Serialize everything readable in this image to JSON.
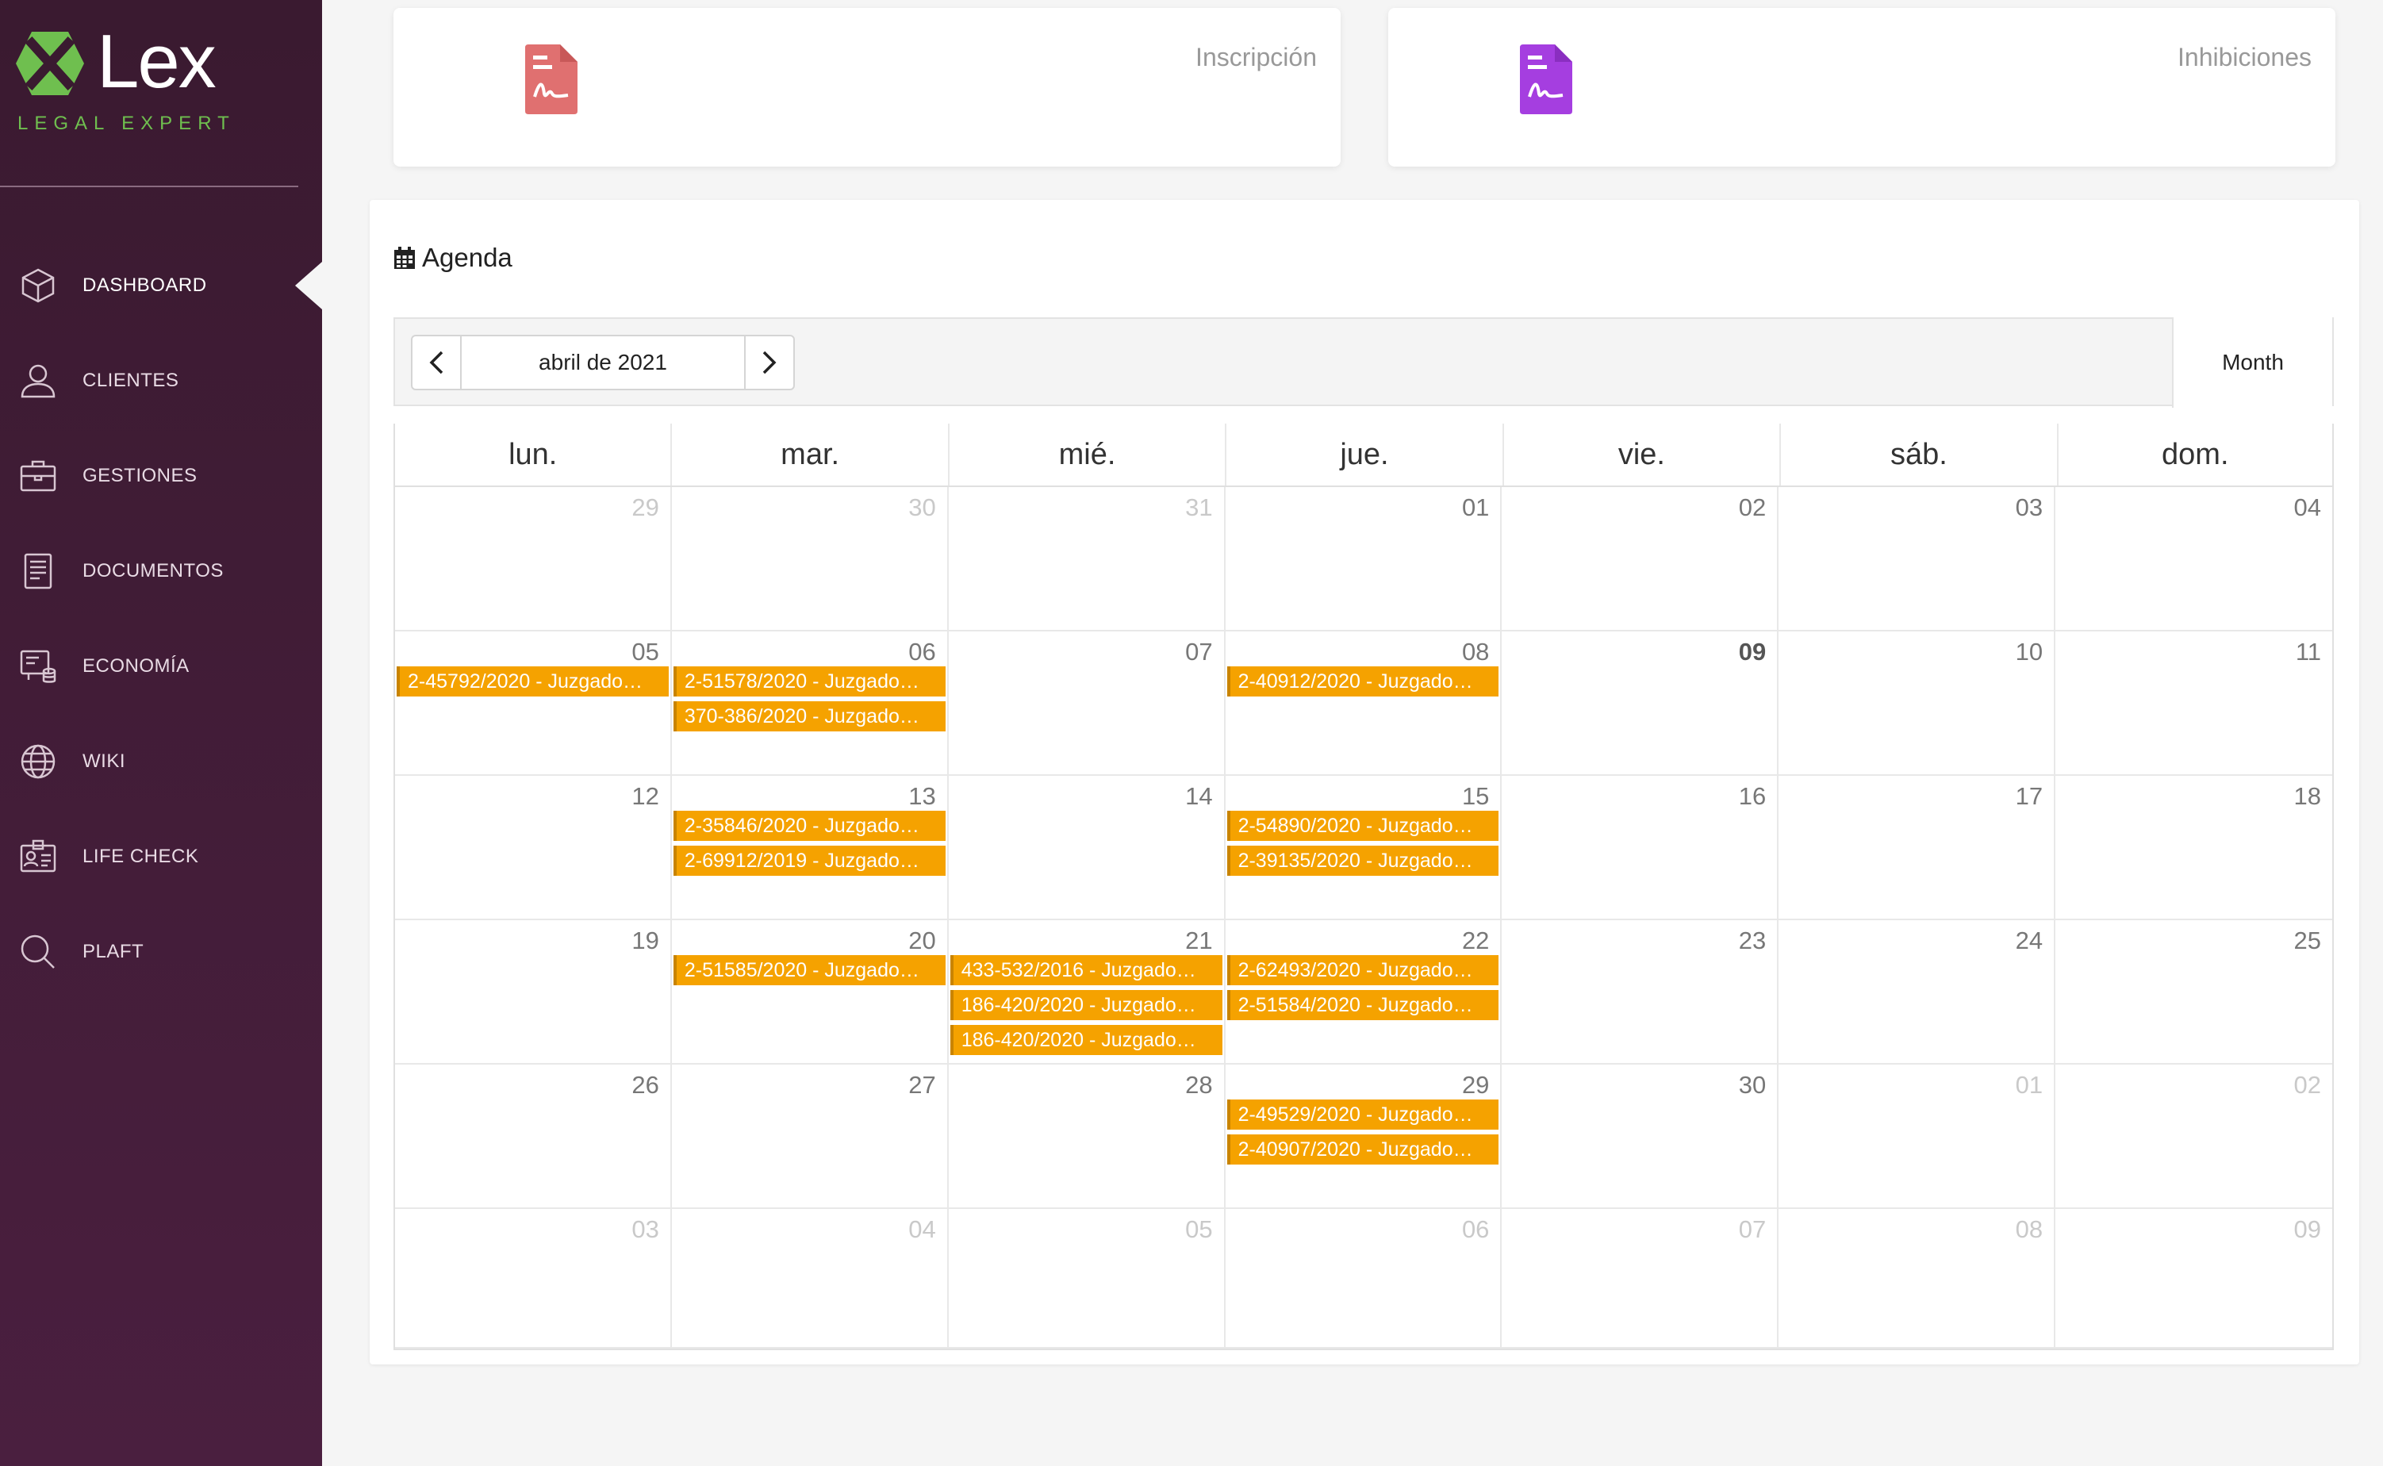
{
  "brand": {
    "name": "Lex",
    "tagline": "LEGAL EXPERT",
    "accent": "#6fbf4f",
    "sidebar_color": "#3f1c36"
  },
  "sidebar": {
    "items": [
      {
        "label": "DASHBOARD",
        "icon": "cube-icon",
        "active": true
      },
      {
        "label": "CLIENTES",
        "icon": "user-icon"
      },
      {
        "label": "GESTIONES",
        "icon": "briefcase-icon"
      },
      {
        "label": "DOCUMENTOS",
        "icon": "document-icon"
      },
      {
        "label": "ECONOMÍA",
        "icon": "finance-icon"
      },
      {
        "label": "WIKI",
        "icon": "globe-icon"
      },
      {
        "label": "LIFE CHECK",
        "icon": "id-card-icon"
      },
      {
        "label": "PLAFT",
        "icon": "search-icon"
      }
    ]
  },
  "cards": [
    {
      "title": "Inscripción",
      "icon": "signed-document-icon",
      "icon_color": "#e07070"
    },
    {
      "title": "Inhibiciones",
      "icon": "signed-document-icon",
      "icon_color": "#a53ee0"
    }
  ],
  "agenda": {
    "title": "Agenda",
    "month_label": "abril de 2021",
    "view_label": "Month",
    "event_color": "#f5a200",
    "weekdays": [
      "lun.",
      "mar.",
      "mié.",
      "jue.",
      "vie.",
      "sáb.",
      "dom."
    ],
    "weeks": [
      [
        {
          "day": "29",
          "muted": true,
          "events": []
        },
        {
          "day": "30",
          "muted": true,
          "events": []
        },
        {
          "day": "31",
          "muted": true,
          "events": []
        },
        {
          "day": "01",
          "events": []
        },
        {
          "day": "02",
          "events": []
        },
        {
          "day": "03",
          "events": []
        },
        {
          "day": "04",
          "events": []
        }
      ],
      [
        {
          "day": "05",
          "events": [
            "2-45792/2020 - Juzgado…"
          ]
        },
        {
          "day": "06",
          "events": [
            "2-51578/2020 - Juzgado…",
            "370-386/2020 - Juzgado…"
          ]
        },
        {
          "day": "07",
          "events": []
        },
        {
          "day": "08",
          "events": [
            "2-40912/2020 - Juzgado…"
          ]
        },
        {
          "day": "09",
          "today": true,
          "events": []
        },
        {
          "day": "10",
          "events": []
        },
        {
          "day": "11",
          "events": []
        }
      ],
      [
        {
          "day": "12",
          "events": []
        },
        {
          "day": "13",
          "events": [
            "2-35846/2020 - Juzgado…",
            "2-69912/2019 - Juzgado…"
          ]
        },
        {
          "day": "14",
          "events": []
        },
        {
          "day": "15",
          "events": [
            "2-54890/2020 - Juzgado…",
            "2-39135/2020 - Juzgado…"
          ]
        },
        {
          "day": "16",
          "events": []
        },
        {
          "day": "17",
          "events": []
        },
        {
          "day": "18",
          "events": []
        }
      ],
      [
        {
          "day": "19",
          "events": []
        },
        {
          "day": "20",
          "events": [
            "2-51585/2020 - Juzgado…"
          ]
        },
        {
          "day": "21",
          "events": [
            "433-532/2016 - Juzgado…",
            "186-420/2020 - Juzgado…",
            "186-420/2020 - Juzgado…"
          ]
        },
        {
          "day": "22",
          "events": [
            "2-62493/2020 - Juzgado…",
            "2-51584/2020 - Juzgado…"
          ]
        },
        {
          "day": "23",
          "events": []
        },
        {
          "day": "24",
          "events": []
        },
        {
          "day": "25",
          "events": []
        }
      ],
      [
        {
          "day": "26",
          "events": []
        },
        {
          "day": "27",
          "events": []
        },
        {
          "day": "28",
          "events": []
        },
        {
          "day": "29",
          "events": [
            "2-49529/2020 - Juzgado…",
            "2-40907/2020 - Juzgado…"
          ]
        },
        {
          "day": "30",
          "events": []
        },
        {
          "day": "01",
          "muted": true,
          "events": []
        },
        {
          "day": "02",
          "muted": true,
          "events": []
        }
      ],
      [
        {
          "day": "03",
          "muted": true,
          "events": []
        },
        {
          "day": "04",
          "muted": true,
          "events": []
        },
        {
          "day": "05",
          "muted": true,
          "events": []
        },
        {
          "day": "06",
          "muted": true,
          "events": []
        },
        {
          "day": "07",
          "muted": true,
          "events": []
        },
        {
          "day": "08",
          "muted": true,
          "events": []
        },
        {
          "day": "09",
          "muted": true,
          "events": []
        }
      ]
    ]
  }
}
